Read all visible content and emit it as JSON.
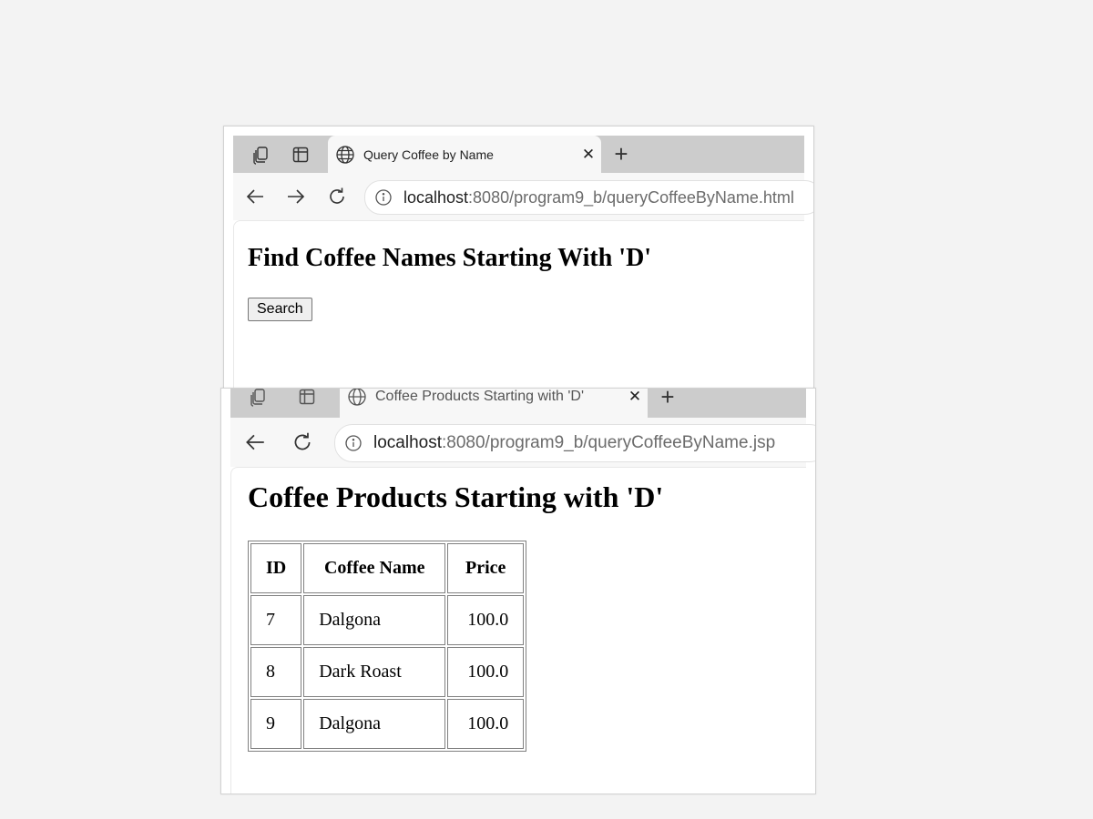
{
  "window1": {
    "tab_title": "Query Coffee by Name",
    "url_host": "localhost",
    "url_path": ":8080/program9_b/queryCoffeeByName.html",
    "heading": "Find Coffee Names Starting With 'D'",
    "search_label": "Search"
  },
  "window2": {
    "tab_title": "Coffee Products Starting with 'D'",
    "url_host": "localhost",
    "url_path": ":8080/program9_b/queryCoffeeByName.jsp",
    "heading": "Coffee Products Starting with 'D'",
    "table": {
      "headers": [
        "ID",
        "Coffee Name",
        "Price"
      ],
      "rows": [
        [
          "7",
          "Dalgona",
          "100.0"
        ],
        [
          "8",
          "Dark Roast",
          "100.0"
        ],
        [
          "9",
          "Dalgona",
          "100.0"
        ]
      ]
    }
  },
  "colors": {
    "tabstrip": "#cccccc",
    "toolbar": "#f7f7f7",
    "desktop": "#f3f3f3"
  },
  "icons": [
    "workspaces-icon",
    "vertical-tabs-icon",
    "globe-icon",
    "close-icon",
    "new-tab-icon",
    "back-icon",
    "forward-icon",
    "reload-icon",
    "info-icon"
  ]
}
